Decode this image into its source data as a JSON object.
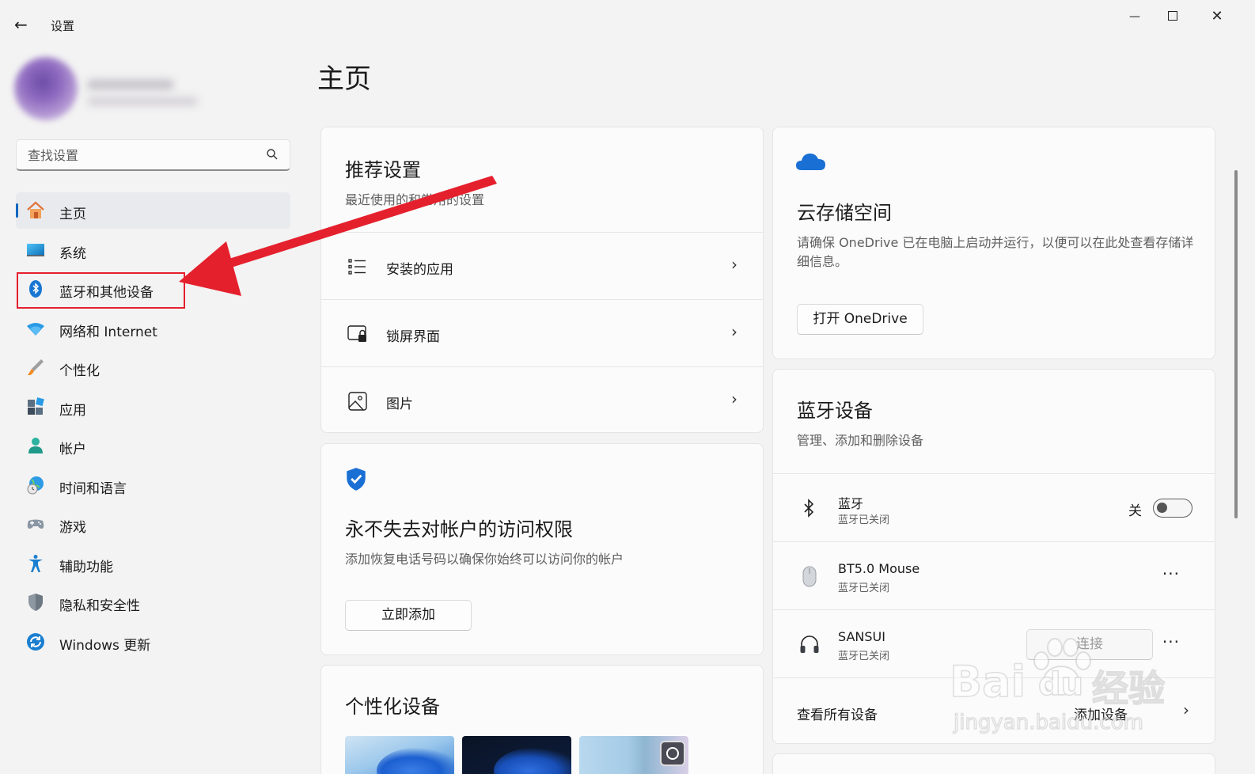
{
  "window": {
    "title": "设置",
    "back_icon": "←",
    "minimize_icon": "—",
    "close_icon": "✕"
  },
  "search": {
    "placeholder": "查找设置"
  },
  "sidebar": {
    "items": [
      {
        "label": "主页",
        "icon": "home-icon",
        "active": true
      },
      {
        "label": "系统",
        "icon": "system-icon"
      },
      {
        "label": "蓝牙和其他设备",
        "icon": "bluetooth-icon"
      },
      {
        "label": "网络和 Internet",
        "icon": "wifi-icon"
      },
      {
        "label": "个性化",
        "icon": "brush-icon"
      },
      {
        "label": "应用",
        "icon": "apps-icon"
      },
      {
        "label": "帐户",
        "icon": "account-icon"
      },
      {
        "label": "时间和语言",
        "icon": "globe-clock-icon"
      },
      {
        "label": "游戏",
        "icon": "gamepad-icon"
      },
      {
        "label": "辅助功能",
        "icon": "accessibility-icon"
      },
      {
        "label": "隐私和安全性",
        "icon": "shield-icon"
      },
      {
        "label": "Windows 更新",
        "icon": "update-icon"
      }
    ]
  },
  "main": {
    "title": "主页",
    "recommended": {
      "title": "推荐设置",
      "subtitle": "最近使用的和常用的设置",
      "rows": [
        {
          "label": "安装的应用",
          "icon": "list-icon"
        },
        {
          "label": "锁屏界面",
          "icon": "lock-screen-icon"
        },
        {
          "label": "图片",
          "icon": "picture-icon"
        }
      ],
      "chevron": "›"
    },
    "account_access": {
      "title": "永不失去对帐户的访问权限",
      "subtitle": "添加恢复电话号码以确保你始终可以访问你的帐户",
      "button": "立即添加"
    },
    "personalize": {
      "title": "个性化设备"
    },
    "cloud": {
      "title": "云存储空间",
      "subtitle": "请确保 OneDrive 已在电脑上启动并运行，以便可以在此处查看存储详细信息。",
      "button": "打开 OneDrive"
    },
    "bluetooth": {
      "title": "蓝牙设备",
      "subtitle": "管理、添加和删除设备",
      "toggle": {
        "name": "蓝牙",
        "status": "蓝牙已关闭",
        "state_label": "关",
        "on": false
      },
      "devices": [
        {
          "name": "BT5.0 Mouse",
          "status": "蓝牙已关闭",
          "icon": "mouse-icon"
        },
        {
          "name": "SANSUI",
          "status": "蓝牙已关闭",
          "icon": "headphones-icon",
          "action": "连接"
        }
      ],
      "more": "···",
      "footer": {
        "view_all": "查看所有设备",
        "add": "添加设备",
        "chevron": "›"
      }
    }
  },
  "watermark": {
    "brand": "Bai",
    "brand2": "du",
    "cn": "经验",
    "url": "jingyan.baidu.com"
  },
  "colors": {
    "accent": "#0067c0",
    "annotation": "#e5202d"
  }
}
